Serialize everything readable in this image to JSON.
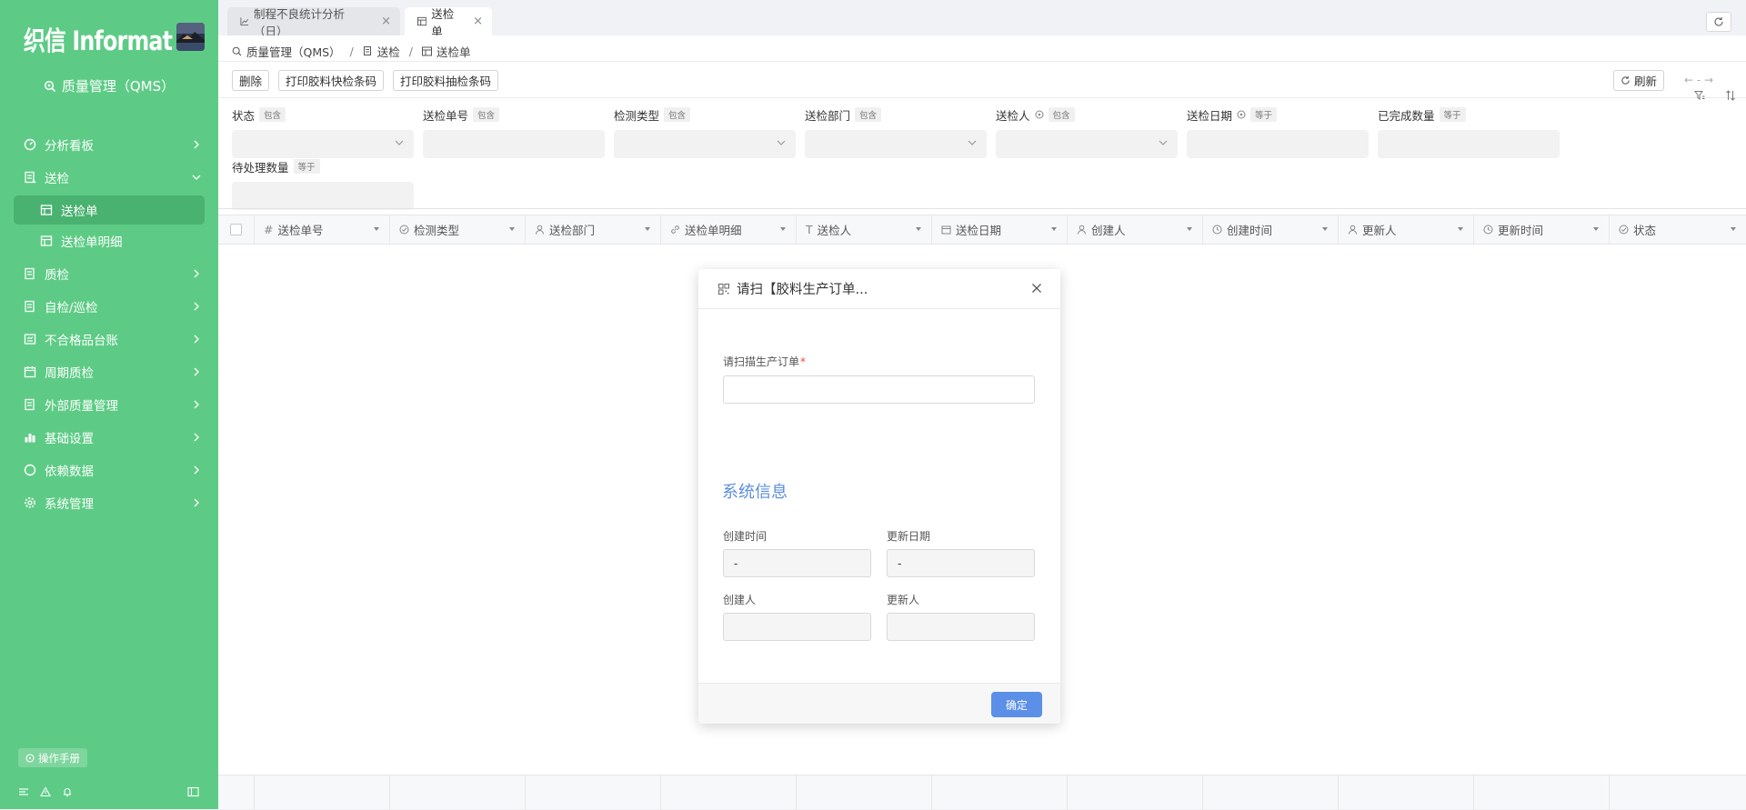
{
  "sidebar": {
    "logo_text": "织信 Informat",
    "app_title": "质量管理（QMS）",
    "items": [
      {
        "label": "分析看板",
        "icon": "dashboard-icon"
      },
      {
        "label": "送检",
        "icon": "document-icon",
        "expanded": true
      },
      {
        "label": "送检单",
        "icon": "table-icon",
        "sub": true,
        "active": true
      },
      {
        "label": "送检单明细",
        "icon": "table-icon",
        "sub": true
      },
      {
        "label": "质检",
        "icon": "document-icon"
      },
      {
        "label": "自检/巡检",
        "icon": "document-icon"
      },
      {
        "label": "不合格品台账",
        "icon": "ledger-icon"
      },
      {
        "label": "周期质检",
        "icon": "calendar-icon"
      },
      {
        "label": "外部质量管理",
        "icon": "document-icon"
      },
      {
        "label": "基础设置",
        "icon": "bar-chart-icon"
      },
      {
        "label": "依赖数据",
        "icon": "circle-icon"
      },
      {
        "label": "系统管理",
        "icon": "gear-icon"
      }
    ],
    "manual_label": "操作手册"
  },
  "tabs": [
    {
      "label": "制程不良统计分析（日）",
      "active": false
    },
    {
      "label": "送检单",
      "active": true
    }
  ],
  "breadcrumb": [
    "质量管理（QMS）",
    "送检",
    "送检单"
  ],
  "toolbar": {
    "delete_label": "删除",
    "print_fast_label": "打印胶料快检条码",
    "print_sample_label": "打印胶料抽检条码",
    "refresh_label": "刷新",
    "pager_text": "←  -  →"
  },
  "filters": [
    {
      "label": "状态",
      "op": "包含"
    },
    {
      "label": "送检单号",
      "op": "包含"
    },
    {
      "label": "检测类型",
      "op": "包含"
    },
    {
      "label": "送检部门",
      "op": "包含"
    },
    {
      "label": "送检人",
      "op": "包含"
    },
    {
      "label": "送检日期",
      "op": "等于"
    },
    {
      "label": "已完成数量",
      "op": "等于"
    },
    {
      "label": "待处理数量",
      "op": "等于"
    }
  ],
  "table": {
    "columns": [
      "送检单号",
      "检测类型",
      "送检部门",
      "送检单明细",
      "送检人",
      "送检日期",
      "创建人",
      "创建时间",
      "更新人",
      "更新时间",
      "状态"
    ]
  },
  "modal": {
    "title": "请扫【胶料生产订单...",
    "scan_label": "请扫描生产订单",
    "required_mark": "*",
    "section_title": "系统信息",
    "created_time_label": "创建时间",
    "created_time_value": "-",
    "updated_date_label": "更新日期",
    "updated_date_value": "-",
    "creator_label": "创建人",
    "updater_label": "更新人",
    "ok_label": "确定"
  },
  "colors": {
    "sidebar_bg": "#5dcb85",
    "sidebar_active": "#49b270",
    "primary_button": "#5b8fe8",
    "section_title": "#5b8fe0"
  }
}
